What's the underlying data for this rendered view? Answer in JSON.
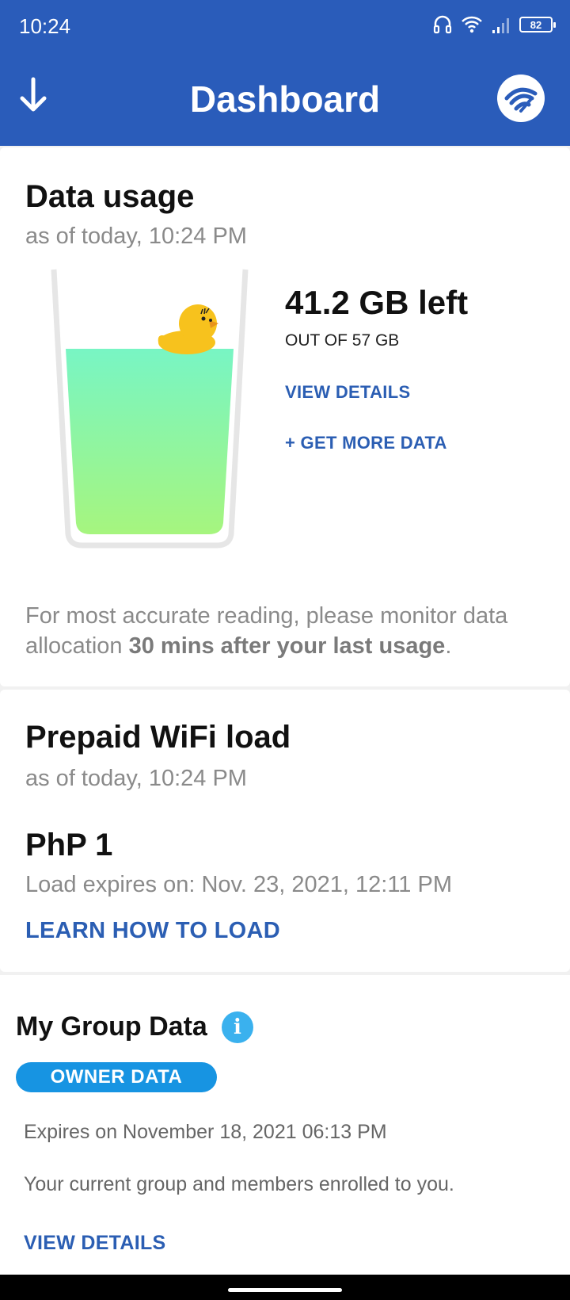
{
  "status_bar": {
    "time": "10:24",
    "battery": "82"
  },
  "header": {
    "title": "Dashboard"
  },
  "data_usage": {
    "title": "Data usage",
    "as_of": "as of today, 10:24 PM",
    "remaining": "41.2 GB left",
    "total": "OUT OF 57 GB",
    "fill_fraction": 0.72,
    "view_details": "VIEW DETAILS",
    "get_more": "+ GET MORE DATA",
    "note_prefix": "For most accurate reading, please monitor data allocation ",
    "note_bold": "30 mins after your last usage",
    "note_suffix": "."
  },
  "prepaid": {
    "title": "Prepaid WiFi load",
    "as_of": "as of today, 10:24 PM",
    "amount": "PhP 1",
    "expires": "Load expires on: Nov. 23, 2021, 12:11 PM",
    "learn": "LEARN HOW TO LOAD"
  },
  "group": {
    "title": "My Group Data",
    "info_icon": "i",
    "badge": "OWNER DATA",
    "expires": "Expires on November 18, 2021 06:13 PM",
    "description": "Your current group and members enrolled to you.",
    "view_details": "VIEW DETAILS"
  },
  "colors": {
    "header": "#2a5cba",
    "link": "#2b5eb3",
    "badge": "#1794e2",
    "info": "#3ab1ee"
  }
}
